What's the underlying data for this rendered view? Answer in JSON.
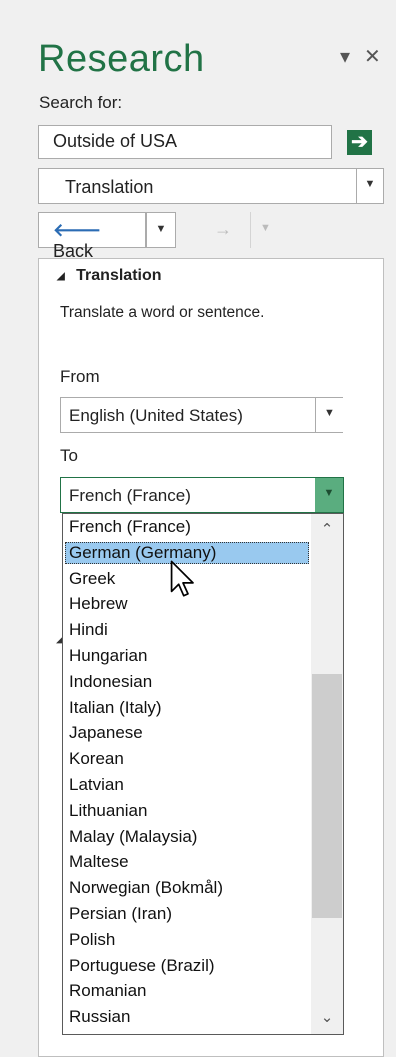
{
  "pane": {
    "title": "Research",
    "menu_glyph": "▾",
    "close_glyph": "✕"
  },
  "search": {
    "label": "Search for:",
    "value": "Outside of USA",
    "go_glyph": "➔"
  },
  "source": {
    "value": "Translation",
    "arrow": "▼"
  },
  "nav": {
    "back_arrow": "🡐",
    "back_label": "Back",
    "drop": "▼",
    "forward_arrow": "→"
  },
  "translation": {
    "heading": "Translation",
    "collapse_glyph": "◢",
    "description": "Translate a word or sentence.",
    "from_label": "From",
    "from_value": "English (United States)",
    "to_label": "To",
    "to_value": "French (France)",
    "arrow": "▼"
  },
  "languages": {
    "highlighted_index": 1,
    "items": [
      "French (France)",
      "German (Germany)",
      "Greek",
      "Hebrew",
      "Hindi",
      "Hungarian",
      "Indonesian",
      "Italian (Italy)",
      "Japanese",
      "Korean",
      "Latvian",
      "Lithuanian",
      "Malay (Malaysia)",
      "Maltese",
      "Norwegian (Bokmål)",
      "Persian (Iran)",
      "Polish",
      "Portuguese (Brazil)",
      "Romanian",
      "Russian"
    ],
    "scroll_up": "⌃",
    "scroll_down": "⌄"
  },
  "colors": {
    "accent": "#217346",
    "highlight": "#99c9ef"
  }
}
